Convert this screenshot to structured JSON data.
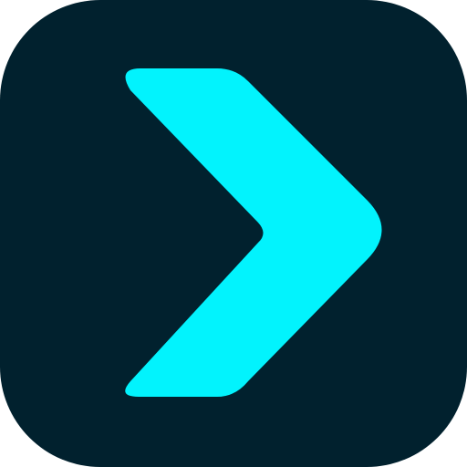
{
  "icon": {
    "name": "chevron-right-icon",
    "colors": {
      "background": "#01212E",
      "chevron": "#02F3FD"
    }
  }
}
